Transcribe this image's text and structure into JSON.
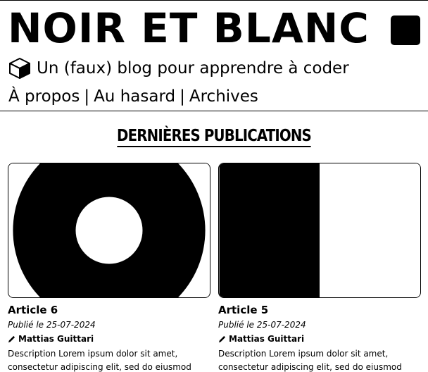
{
  "header": {
    "site_title": "NOIR ET BLANC",
    "tagline": "Un (faux) blog pour apprendre à coder",
    "tagline_icon": "cube-icon",
    "theme_toggle_icon": "black-square-icon",
    "nav": {
      "about": "À propos",
      "random": "Au hasard",
      "archives": "Archives",
      "separator": "|"
    }
  },
  "main": {
    "section_title": "DERNIÈRES PUBLICATIONS",
    "articles": [
      {
        "title": "Article 6",
        "date": "Publié le 25-07-2024",
        "author": "Mattias Guittari",
        "author_icon": "pencil-icon",
        "thumbnail": "black-ring-image",
        "description": "Description Lorem ipsum dolor sit amet, consectetur adipiscing elit, sed do eiusmod tempor incididunt ut"
      },
      {
        "title": "Article 5",
        "date": "Publié le 25-07-2024",
        "author": "Mattias Guittari",
        "author_icon": "pencil-icon",
        "thumbnail": "half-black-half-white-image",
        "description": "Description Lorem ipsum dolor sit amet, consectetur adipiscing elit, sed do eiusmod tempor incididunt ut"
      }
    ]
  },
  "colors": {
    "foreground": "#000000",
    "background": "#ffffff"
  }
}
